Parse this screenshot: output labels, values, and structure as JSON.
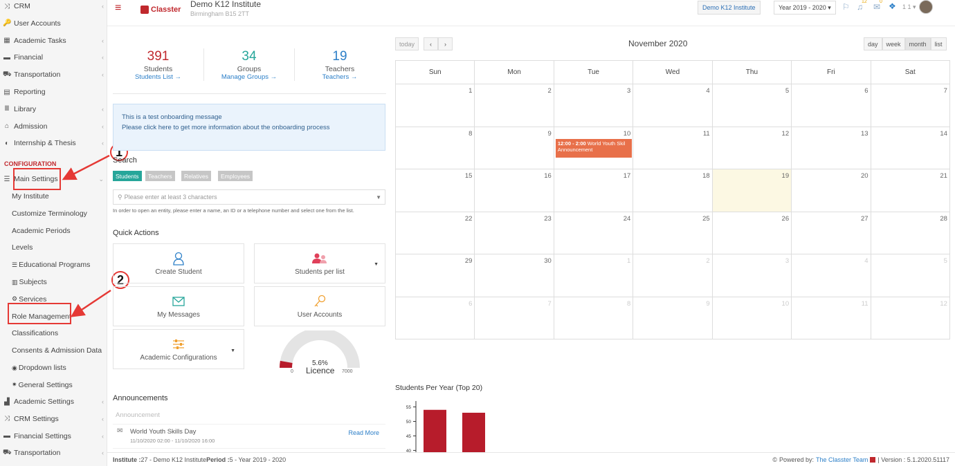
{
  "sidebar": {
    "items": [
      {
        "label": "CRM",
        "icon": "crm-icon",
        "glyph": "⤨",
        "chev": true
      },
      {
        "label": "User Accounts",
        "icon": "key-icon",
        "glyph": "🔑",
        "chev": false
      },
      {
        "label": "Academic Tasks",
        "icon": "tasks-icon",
        "glyph": "▦",
        "chev": true
      },
      {
        "label": "Financial",
        "icon": "money-icon",
        "glyph": "▬",
        "chev": true
      },
      {
        "label": "Transportation",
        "icon": "bus-icon",
        "glyph": "⛟",
        "chev": true
      },
      {
        "label": "Reporting",
        "icon": "print-icon",
        "glyph": "▤",
        "chev": false
      },
      {
        "label": "Library",
        "icon": "library-icon",
        "glyph": "Ⅲ",
        "chev": true
      },
      {
        "label": "Admission",
        "icon": "bank-icon",
        "glyph": "⌂",
        "chev": true
      },
      {
        "label": "Internship & Thesis",
        "icon": "internship-icon",
        "glyph": "◐",
        "chev": true
      }
    ],
    "config_label": "CONFIGURATION",
    "main_settings": "Main Settings",
    "sub": [
      {
        "label": "My Institute",
        "icon": "",
        "glyph": ""
      },
      {
        "label": "Customize Terminology",
        "icon": "",
        "glyph": ""
      },
      {
        "label": "Academic Periods",
        "icon": "",
        "glyph": ""
      },
      {
        "label": "Levels",
        "icon": "",
        "glyph": ""
      },
      {
        "label": "Educational Programs",
        "icon": "programs-icon",
        "glyph": "☰"
      },
      {
        "label": "Subjects",
        "icon": "subjects-icon",
        "glyph": "▥"
      },
      {
        "label": "Services",
        "icon": "services-icon",
        "glyph": "⚙"
      },
      {
        "label": "Role Management",
        "icon": "",
        "glyph": ""
      },
      {
        "label": "Classifications",
        "icon": "",
        "glyph": ""
      },
      {
        "label": "Consents & Admission Data",
        "icon": "",
        "glyph": ""
      },
      {
        "label": "Dropdown lists",
        "icon": "dropdown-icon",
        "glyph": "◉"
      },
      {
        "label": "General Settings",
        "icon": "settings-icon",
        "glyph": "✷"
      }
    ],
    "bottom": [
      {
        "label": "Academic Settings",
        "icon": "academic-settings-icon",
        "glyph": "▟"
      },
      {
        "label": "CRM Settings",
        "icon": "crm-settings-icon",
        "glyph": "⤨"
      },
      {
        "label": "Financial Settings",
        "icon": "financial-settings-icon",
        "glyph": "▬"
      },
      {
        "label": "Transportation",
        "icon": "bus-icon",
        "glyph": "⛟"
      }
    ]
  },
  "annotations": {
    "step1": "1",
    "step2": "2"
  },
  "header": {
    "menu_glyph": "≡",
    "logo_text": "Classter",
    "institute_name": "Demo K12 Institute",
    "institute_address": "Birmingham B15 2TT",
    "institute_btn": "Demo K12 Institute",
    "year_btn": "Year 2019 - 2020 ▾",
    "badge_flag": "12",
    "badge_mail": "0",
    "user_count": "1 1 ▾"
  },
  "stats": [
    {
      "num": "391",
      "label": "Students",
      "link": "Students List →",
      "color": "#c0282d"
    },
    {
      "num": "34",
      "label": "Groups",
      "link": "Manage Groups →",
      "color": "#26a69a"
    },
    {
      "num": "19",
      "label": "Teachers",
      "link": "Teachers →",
      "color": "#2c7fc8"
    }
  ],
  "onboarding": {
    "line1": "This is a test onboarding message",
    "line2": "Please click here to get more information about the onboarding process"
  },
  "search": {
    "label": "Search",
    "tabs": [
      "Students",
      "Teachers",
      "Relatives",
      "Employees"
    ],
    "placeholder": "Please enter at least 3 characters",
    "help": "In order to open an entity, please enter a name, an ID or a telephone number and select one from the list."
  },
  "quick_actions": {
    "title": "Quick Actions",
    "items": [
      "Create Student",
      "Students per list",
      "My Messages",
      "User Accounts",
      "Academic Configurations"
    ]
  },
  "licence": {
    "percent": "5.6%",
    "label": "Licence",
    "min": "0",
    "max": "7000",
    "fraction": 0.056
  },
  "announcements": {
    "title": "Announcements",
    "subtitle": "Announcement",
    "item_title": "World Youth Skills Day",
    "item_date": "11/10/2020 02:00 - 11/10/2020 16:00",
    "read_more": "Read More"
  },
  "calendar": {
    "today_btn": "today",
    "prev": "‹",
    "next": "›",
    "title": "November 2020",
    "views": [
      "day",
      "week",
      "month",
      "list"
    ],
    "days": [
      "Sun",
      "Mon",
      "Tue",
      "Wed",
      "Thu",
      "Fri",
      "Sat"
    ],
    "weeks": [
      [
        "1",
        "2",
        "3",
        "4",
        "5",
        "6",
        "7"
      ],
      [
        "8",
        "9",
        "10",
        "11",
        "12",
        "13",
        "14"
      ],
      [
        "15",
        "16",
        "17",
        "18",
        "19",
        "20",
        "21"
      ],
      [
        "22",
        "23",
        "24",
        "25",
        "26",
        "27",
        "28"
      ],
      [
        "29",
        "30",
        "1",
        "2",
        "3",
        "4",
        "5"
      ],
      [
        "6",
        "7",
        "8",
        "9",
        "10",
        "11",
        "12"
      ]
    ],
    "event_time": "12:00 - 2:00",
    "event_title": "World Youth Skil",
    "event_line2": "Announcement",
    "today_date": "19"
  },
  "chart_data": {
    "type": "bar",
    "title": "Students Per Year (Top 20)",
    "categories": [
      "",
      ""
    ],
    "values": [
      54,
      53
    ],
    "yticks": [
      40,
      45,
      50,
      55
    ],
    "ylim": [
      37,
      58
    ],
    "color": "#b71c2b"
  },
  "footer": {
    "left_a": "Institute :",
    "left_b": " 27 - Demo K12 Institute ",
    "left_c": "Period :",
    "left_d": " 5 - Year 2019 - 2020",
    "powered": "Powered by:",
    "team": "The Classter Team",
    "version": "| Version : 5.1.2020.51117"
  }
}
